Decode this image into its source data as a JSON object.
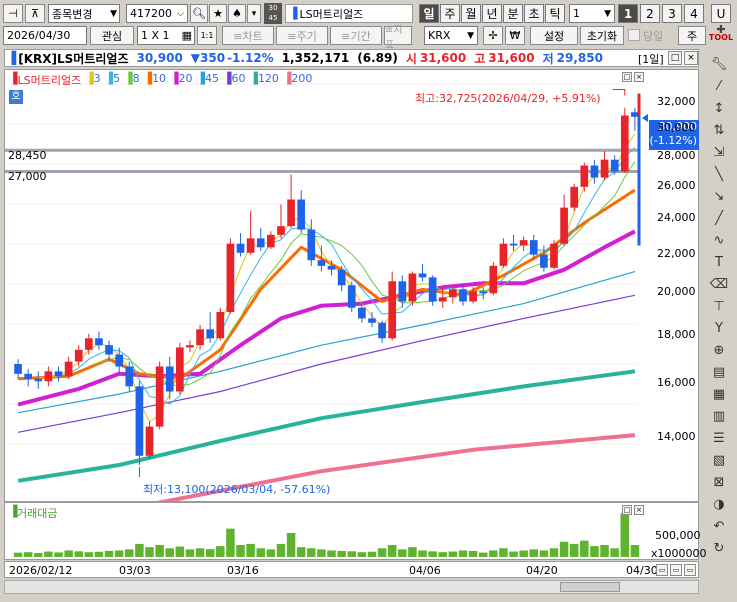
{
  "toolbar1": {
    "stock_change_label": "종목변경",
    "code_value": "417200",
    "code_badge": "30\n45",
    "stock_name": "LS머트리얼즈",
    "periods": [
      "일",
      "주",
      "월",
      "년",
      "분",
      "초",
      "틱"
    ],
    "period_value": "1",
    "pages": [
      "1",
      "2",
      "3",
      "4"
    ],
    "u_label": "U"
  },
  "toolbar2": {
    "date_value": "2026/04/30",
    "interest_label": "관심",
    "layout_value": "1 X 1",
    "one_one": "1:1",
    "chart_label": "≡차트",
    "weekly_label": "≡주기",
    "period_label": "≡기간",
    "indicator_label": "≡지표",
    "market_value": "KRX",
    "settings_label": "설정",
    "reset_label": "초기화",
    "today_label": "당일",
    "tool_label": "TOOL"
  },
  "infobar": {
    "name": "[KRX]LS머트리얼즈",
    "price": "30,900",
    "change": "▼350",
    "pct": "-1.12%",
    "volume": "1,352,171",
    "vol_ratio": "(6.89)",
    "open_label": "시",
    "open": "31,600",
    "high_label": "고",
    "high": "31,600",
    "low_label": "저",
    "low": "29,850",
    "period_tag": "[1일]"
  },
  "legend": {
    "name": "LS머트리얼즈",
    "ma": [
      {
        "label": "3",
        "color": "#e8c21a"
      },
      {
        "label": "5",
        "color": "#33b8e8"
      },
      {
        "label": "8",
        "color": "#6dc83d"
      },
      {
        "label": "10",
        "color": "#ff6a00"
      },
      {
        "label": "20",
        "color": "#d21fd2"
      },
      {
        "label": "45",
        "color": "#2aa0d8"
      },
      {
        "label": "60",
        "color": "#7a3ad8"
      },
      {
        "label": "120",
        "color": "#29b39a"
      },
      {
        "label": "200",
        "color": "#f07090"
      }
    ]
  },
  "annotations": {
    "high_note": "최고:32,725(2026/04/29, +5.91%)",
    "low_note": "최저:13,100(2026/03/04, -57.61%)",
    "line1_label": "28,450",
    "line2_label": "27,000",
    "price_tag": "30,900",
    "price_tag_pct": "(-1.12%)",
    "volume_title": "거래대금",
    "volume_tick": "500,000",
    "volume_unit": "x1000000",
    "ho_label": "호"
  },
  "chart_data": {
    "type": "candlestick",
    "y_ticks": [
      "32,000",
      "30,000",
      "28,000",
      "26,000",
      "24,000",
      "22,000",
      "20,000",
      "18,000",
      "16,000",
      "14,000"
    ],
    "x_ticks": [
      "2026/02/12",
      "03/03",
      "03/16",
      "04/06",
      "04/20",
      "04/30"
    ],
    "ylim": [
      12500,
      33500
    ],
    "candles": [
      [
        16800,
        17000,
        16200,
        16400
      ],
      [
        16400,
        16600,
        15900,
        16200
      ],
      [
        16200,
        16500,
        15800,
        16100
      ],
      [
        16100,
        16700,
        15900,
        16500
      ],
      [
        16500,
        16700,
        16100,
        16300
      ],
      [
        16300,
        17100,
        16200,
        16900
      ],
      [
        16900,
        17600,
        16700,
        17400
      ],
      [
        17400,
        18100,
        17200,
        17900
      ],
      [
        17900,
        18200,
        17400,
        17600
      ],
      [
        17600,
        17800,
        16900,
        17200
      ],
      [
        17200,
        17500,
        16400,
        16700
      ],
      [
        16700,
        16900,
        15700,
        15900
      ],
      [
        15900,
        16100,
        13100,
        13400
      ],
      [
        13400,
        14600,
        13300,
        14400
      ],
      [
        14400,
        16900,
        14300,
        16700
      ],
      [
        16700,
        17100,
        15400,
        15700
      ],
      [
        15700,
        17700,
        15600,
        17500
      ],
      [
        17500,
        17800,
        17300,
        17600
      ],
      [
        17600,
        18500,
        17400,
        18300
      ],
      [
        18300,
        19100,
        17700,
        17900
      ],
      [
        17900,
        19300,
        17800,
        19100
      ],
      [
        19100,
        22900,
        19000,
        22600
      ],
      [
        22600,
        23200,
        21900,
        22100
      ],
      [
        22100,
        24500,
        22000,
        22900
      ],
      [
        22900,
        23500,
        22200,
        22400
      ],
      [
        22400,
        23300,
        22300,
        23100
      ],
      [
        23100,
        24900,
        22900,
        23600
      ],
      [
        23600,
        26800,
        23500,
        25200
      ],
      [
        25200,
        25800,
        23200,
        23400
      ],
      [
        23400,
        24000,
        21400,
        21700
      ],
      [
        21700,
        22500,
        21100,
        21400
      ],
      [
        21400,
        21700,
        20900,
        21200
      ],
      [
        21200,
        21400,
        20100,
        20400
      ],
      [
        20400,
        20600,
        19100,
        19300
      ],
      [
        19300,
        19600,
        18600,
        18800
      ],
      [
        18800,
        19100,
        18400,
        18600
      ],
      [
        18600,
        18700,
        17700,
        17900
      ],
      [
        17900,
        21100,
        17800,
        20600
      ],
      [
        20600,
        20900,
        19300,
        19600
      ],
      [
        19600,
        21100,
        19400,
        21000
      ],
      [
        21000,
        21500,
        20600,
        20800
      ],
      [
        20800,
        20900,
        19400,
        19600
      ],
      [
        19600,
        20300,
        19300,
        19800
      ],
      [
        19800,
        20400,
        19500,
        20200
      ],
      [
        20200,
        20500,
        19400,
        19600
      ],
      [
        19600,
        20300,
        19500,
        20100
      ],
      [
        20100,
        20300,
        19700,
        20000
      ],
      [
        20000,
        21600,
        19900,
        21400
      ],
      [
        21400,
        22900,
        21300,
        22600
      ],
      [
        22600,
        23100,
        22200,
        22500
      ],
      [
        22500,
        23000,
        22200,
        22800
      ],
      [
        22800,
        23100,
        21700,
        22000
      ],
      [
        22000,
        22500,
        21100,
        21300
      ],
      [
        21300,
        22800,
        21200,
        22600
      ],
      [
        22600,
        25500,
        22500,
        24700
      ],
      [
        24700,
        26200,
        24500,
        26000
      ],
      [
        26000,
        27600,
        25700,
        27400
      ],
      [
        27400,
        27800,
        26200,
        26600
      ],
      [
        26600,
        28400,
        26400,
        27800
      ],
      [
        27800,
        28100,
        26800,
        27000
      ],
      [
        27000,
        31600,
        26900,
        31000
      ],
      [
        31250,
        31600,
        29850,
        30900
      ]
    ],
    "ma_paths": {
      "ma10": [
        [
          0,
          16200
        ],
        [
          5,
          16300
        ],
        [
          9,
          17000
        ],
        [
          12,
          16400
        ],
        [
          16,
          16200
        ],
        [
          20,
          17400
        ],
        [
          24,
          20200
        ],
        [
          28,
          22400
        ],
        [
          32,
          21200
        ],
        [
          36,
          19600
        ],
        [
          40,
          20200
        ],
        [
          44,
          19900
        ],
        [
          48,
          20900
        ],
        [
          52,
          22100
        ],
        [
          56,
          23800
        ],
        [
          61,
          25800
        ]
      ],
      "ma20": [
        [
          0,
          15200
        ],
        [
          6,
          15800
        ],
        [
          10,
          16400
        ],
        [
          14,
          16300
        ],
        [
          18,
          16400
        ],
        [
          22,
          17600
        ],
        [
          26,
          18800
        ],
        [
          30,
          19400
        ],
        [
          34,
          19500
        ],
        [
          38,
          19900
        ],
        [
          42,
          20300
        ],
        [
          46,
          20500
        ],
        [
          50,
          20500
        ],
        [
          54,
          21200
        ],
        [
          58,
          22400
        ],
        [
          61,
          23300
        ]
      ],
      "ma45": [
        [
          0,
          14900
        ],
        [
          10,
          15600
        ],
        [
          20,
          16500
        ],
        [
          30,
          17600
        ],
        [
          40,
          18500
        ],
        [
          50,
          19500
        ],
        [
          61,
          21100
        ]
      ],
      "ma60": [
        [
          0,
          14200
        ],
        [
          10,
          14900
        ],
        [
          20,
          15700
        ],
        [
          30,
          16800
        ],
        [
          40,
          17800
        ],
        [
          50,
          18800
        ],
        [
          61,
          19900
        ]
      ],
      "ma120": [
        [
          0,
          12600
        ],
        [
          10,
          13100
        ],
        [
          20,
          13900
        ],
        [
          30,
          14700
        ],
        [
          40,
          15300
        ],
        [
          50,
          15900
        ],
        [
          61,
          16500
        ]
      ],
      "ma200": [
        [
          0,
          11200
        ],
        [
          15,
          12000
        ],
        [
          30,
          12900
        ],
        [
          45,
          13600
        ],
        [
          61,
          14100
        ]
      ]
    },
    "volume": [
      20,
      22,
      18,
      25,
      21,
      30,
      26,
      22,
      24,
      28,
      30,
      35,
      60,
      45,
      55,
      40,
      48,
      35,
      40,
      36,
      50,
      130,
      55,
      60,
      40,
      35,
      60,
      110,
      45,
      40,
      35,
      30,
      28,
      26,
      22,
      24,
      40,
      55,
      35,
      45,
      30,
      26,
      22,
      25,
      30,
      28,
      20,
      30,
      40,
      25,
      30,
      35,
      30,
      40,
      70,
      60,
      75,
      50,
      55,
      40,
      200,
      55
    ],
    "up_color": "#e8242b",
    "down_color": "#1e63e8",
    "price_line_color": "#1e63e8"
  }
}
